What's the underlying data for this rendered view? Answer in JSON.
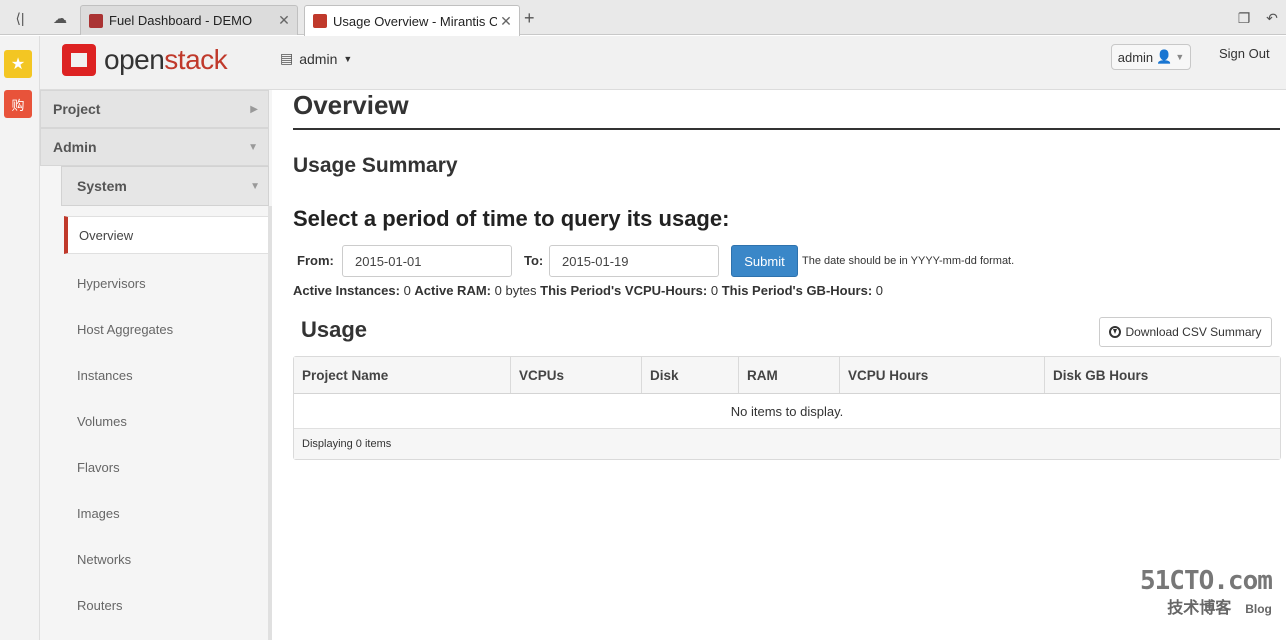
{
  "browser": {
    "tabs": [
      {
        "title": "Fuel Dashboard - DEMO",
        "active": false
      },
      {
        "title": "Usage Overview - Mirantis C",
        "active": true
      }
    ],
    "new_tab": "+"
  },
  "header": {
    "logo_open": "open",
    "logo_stack": "stack",
    "project": "admin",
    "user": "admin",
    "sign_out": "Sign Out"
  },
  "sidebar": {
    "project": "Project",
    "admin": "Admin",
    "system": "System",
    "active": "Overview",
    "items": [
      "Hypervisors",
      "Host Aggregates",
      "Instances",
      "Volumes",
      "Flavors",
      "Images",
      "Networks",
      "Routers"
    ]
  },
  "main": {
    "title": "Overview",
    "summary": "Usage Summary",
    "period_heading": "Select a period of time to query its usage:",
    "from_label": "From:",
    "from_value": "2015-01-01",
    "to_label": "To:",
    "to_value": "2015-01-19",
    "submit": "Submit",
    "hint": "The date should be in YYYY-mm-dd format.",
    "stats": [
      {
        "label": "Active Instances:",
        "value": "0"
      },
      {
        "label": "Active RAM:",
        "value": "0 bytes"
      },
      {
        "label": "This Period's VCPU-Hours:",
        "value": "0"
      },
      {
        "label": "This Period's GB-Hours:",
        "value": "0"
      }
    ],
    "usage_heading": "Usage",
    "csv_button": "Download CSV Summary",
    "table": {
      "columns": [
        "Project Name",
        "VCPUs",
        "Disk",
        "RAM",
        "VCPU Hours",
        "Disk GB Hours"
      ],
      "empty": "No items to display.",
      "footer": "Displaying 0 items"
    }
  },
  "watermark": {
    "line1": "51CTO.com",
    "line2": "技术博客",
    "line3": "Blog"
  },
  "colors": {
    "accent": "#c0392b",
    "submit": "#3a87c8"
  }
}
